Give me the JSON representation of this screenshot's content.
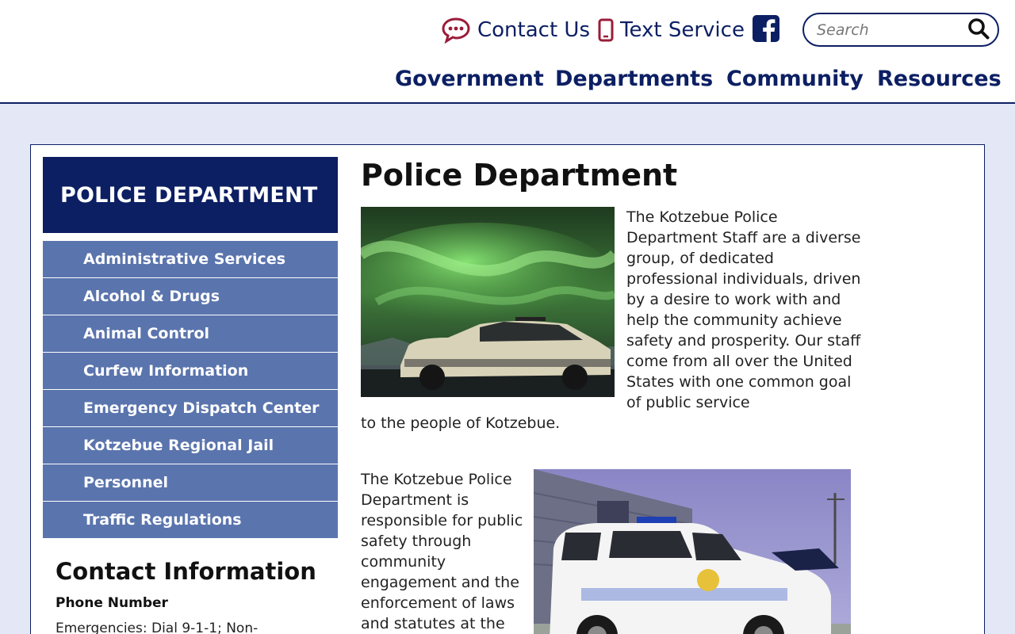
{
  "header": {
    "utility": {
      "contact_label": "Contact Us",
      "text_service_label": "Text Service"
    },
    "search": {
      "placeholder": "Search"
    },
    "nav": [
      "Government",
      "Departments",
      "Community",
      "Resources"
    ]
  },
  "sidebar": {
    "title": "POLICE DEPARTMENT",
    "items": [
      "Administrative Services",
      "Alcohol & Drugs",
      "Animal Control",
      "Curfew Information",
      "Emergency Dispatch Center",
      "Kotzebue Regional Jail",
      "Personnel",
      "Traffic Regulations"
    ],
    "contact": {
      "heading": "Contact Information",
      "phone_heading": "Phone Number",
      "phone_text": "Emergencies: Dial 9-1-1; Non-"
    }
  },
  "main": {
    "title": "Police Department",
    "para1_wrap": "The Kotzebue Police Department Staff are a diverse group, of dedicated professional individuals, driven by a desire to work with and help the community achieve safety and prosperity. Our staff come from all over the United States with one common goal of public service",
    "para1_tail": "to the people of Kotzebue.",
    "para2": "The Kotzebue Police Department is responsible for public safety through community engagement and the enforcement of laws and statutes at the"
  },
  "colors": {
    "navy": "#0c1f63",
    "menu_blue": "#5a74ad",
    "page_bg": "#e4e8f6",
    "contact_icon_red": "#9b1c3a"
  },
  "icons": [
    "chat-bubble-icon",
    "phone-icon",
    "facebook-icon",
    "search-icon"
  ]
}
